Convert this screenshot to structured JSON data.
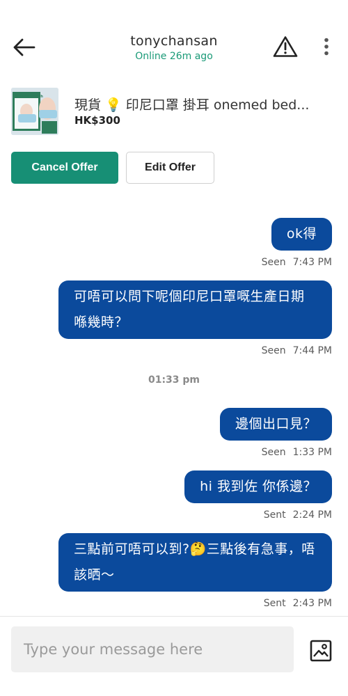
{
  "header": {
    "username": "tonychansan",
    "status": "Online 26m ago",
    "back_icon": "arrow-left-icon",
    "warning_icon": "warning-triangle-icon",
    "more_icon": "more-vertical-icon"
  },
  "product": {
    "title": "現貨 💡 印尼口罩 掛耳 onemed bed...",
    "price": "HK$300",
    "thumb_text": "Masker Bedah"
  },
  "actions": {
    "cancel_offer": "Cancel Offer",
    "edit_offer": "Edit Offer"
  },
  "messages": [
    {
      "text": "ok得",
      "status": "Seen",
      "time": "7:43 PM"
    },
    {
      "text": "可唔可以問下呢個印尼口罩嘅生產日期喺幾時？",
      "status": "Seen",
      "time": "7:44 PM"
    },
    {
      "text": "邊個出口見？",
      "status": "Seen",
      "time": "1:33 PM"
    },
    {
      "text": "hi 我到佐 你係邊？",
      "status": "Sent",
      "time": "2:24 PM"
    },
    {
      "text": "三點前可唔可以到?🤔三點後有急事，唔該晒～",
      "status": "Sent",
      "time": "2:43 PM"
    }
  ],
  "date_separator": "01:33 pm",
  "composer": {
    "placeholder": "Type your message here",
    "image_icon": "image-picker-icon"
  },
  "colors": {
    "accent_green": "#178f75",
    "online_green": "#1a9a77",
    "bubble_blue": "#0b4a9c"
  }
}
